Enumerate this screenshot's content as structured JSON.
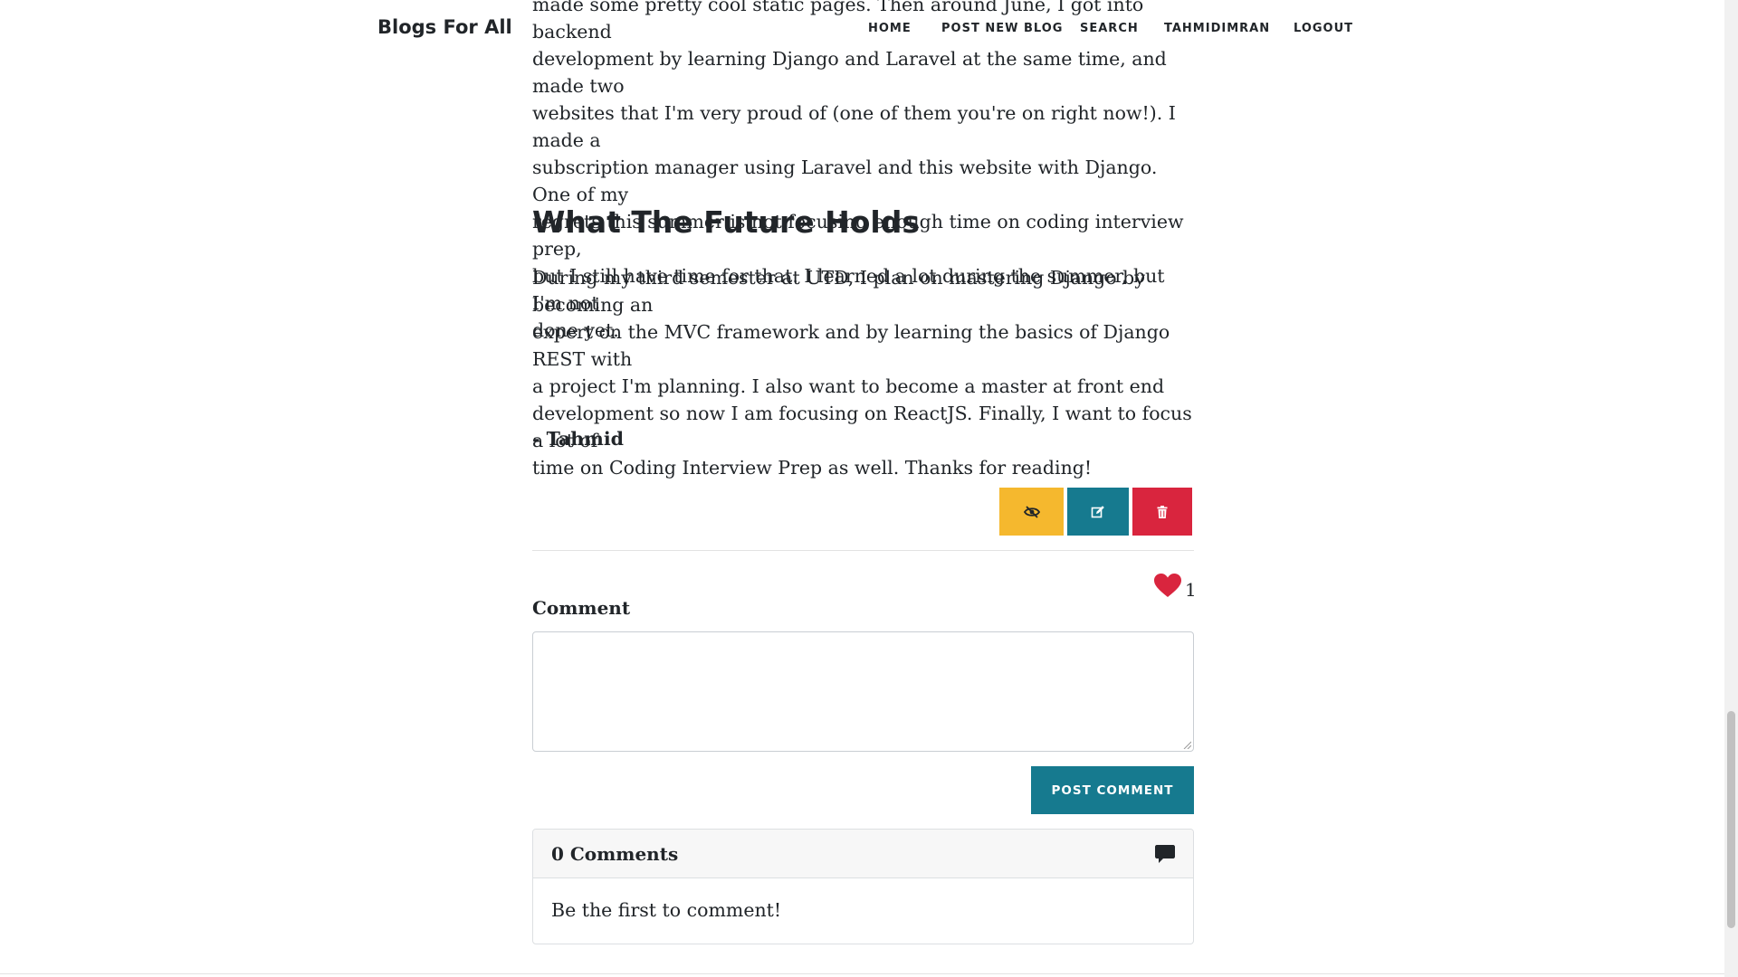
{
  "navbar": {
    "brand": "Blogs For All",
    "links": {
      "home": "HOME",
      "post_new_blog": "POST NEW BLOG",
      "search": "SEARCH",
      "user": "TAHMIDIMRAN",
      "logout": "LOGOUT"
    }
  },
  "article": {
    "intro_lines": [
      "made some pretty cool static pages. Then around June, I got into backend",
      "development by learning Django and Laravel at the same time, and made two",
      "websites that I'm very proud of (one of them you're on right now!). I made a",
      "subscription manager using Laravel and this website with Django. One of my",
      "regrets this summer is not focusing enough time on coding interview prep,",
      "but I still have time for that. I learned a lot during the summer, but I'm not",
      "done yet."
    ],
    "section_title": "What The Future Holds",
    "section_lines": [
      "During my third semester at UTD, I plan on mastering Django by becoming an",
      "expert on the MVC framework and by learning the basics of Django REST with",
      "a project I'm planning. I also want to become a master at front end",
      "development so now I am focusing on ReactJS. Finally, I want to focus a lot of",
      "time on Coding Interview Prep as well. Thanks for reading!"
    ],
    "signature": "- Tahmid"
  },
  "actions": {
    "hide_icon": "eye-slash-icon",
    "edit_icon": "edit-icon",
    "delete_icon": "trash-icon",
    "colors": {
      "hide": "#f5b82e",
      "edit": "#167a8f",
      "delete": "#d9253e"
    }
  },
  "likes": {
    "icon": "heart-icon",
    "count": "1",
    "color": "#d9253e"
  },
  "comment_form": {
    "label": "Comment",
    "value": "",
    "submit_label": "POST COMMENT"
  },
  "comments": {
    "title": "0 Comments",
    "icon": "comment-icon",
    "empty_text": "Be the first to comment!"
  }
}
